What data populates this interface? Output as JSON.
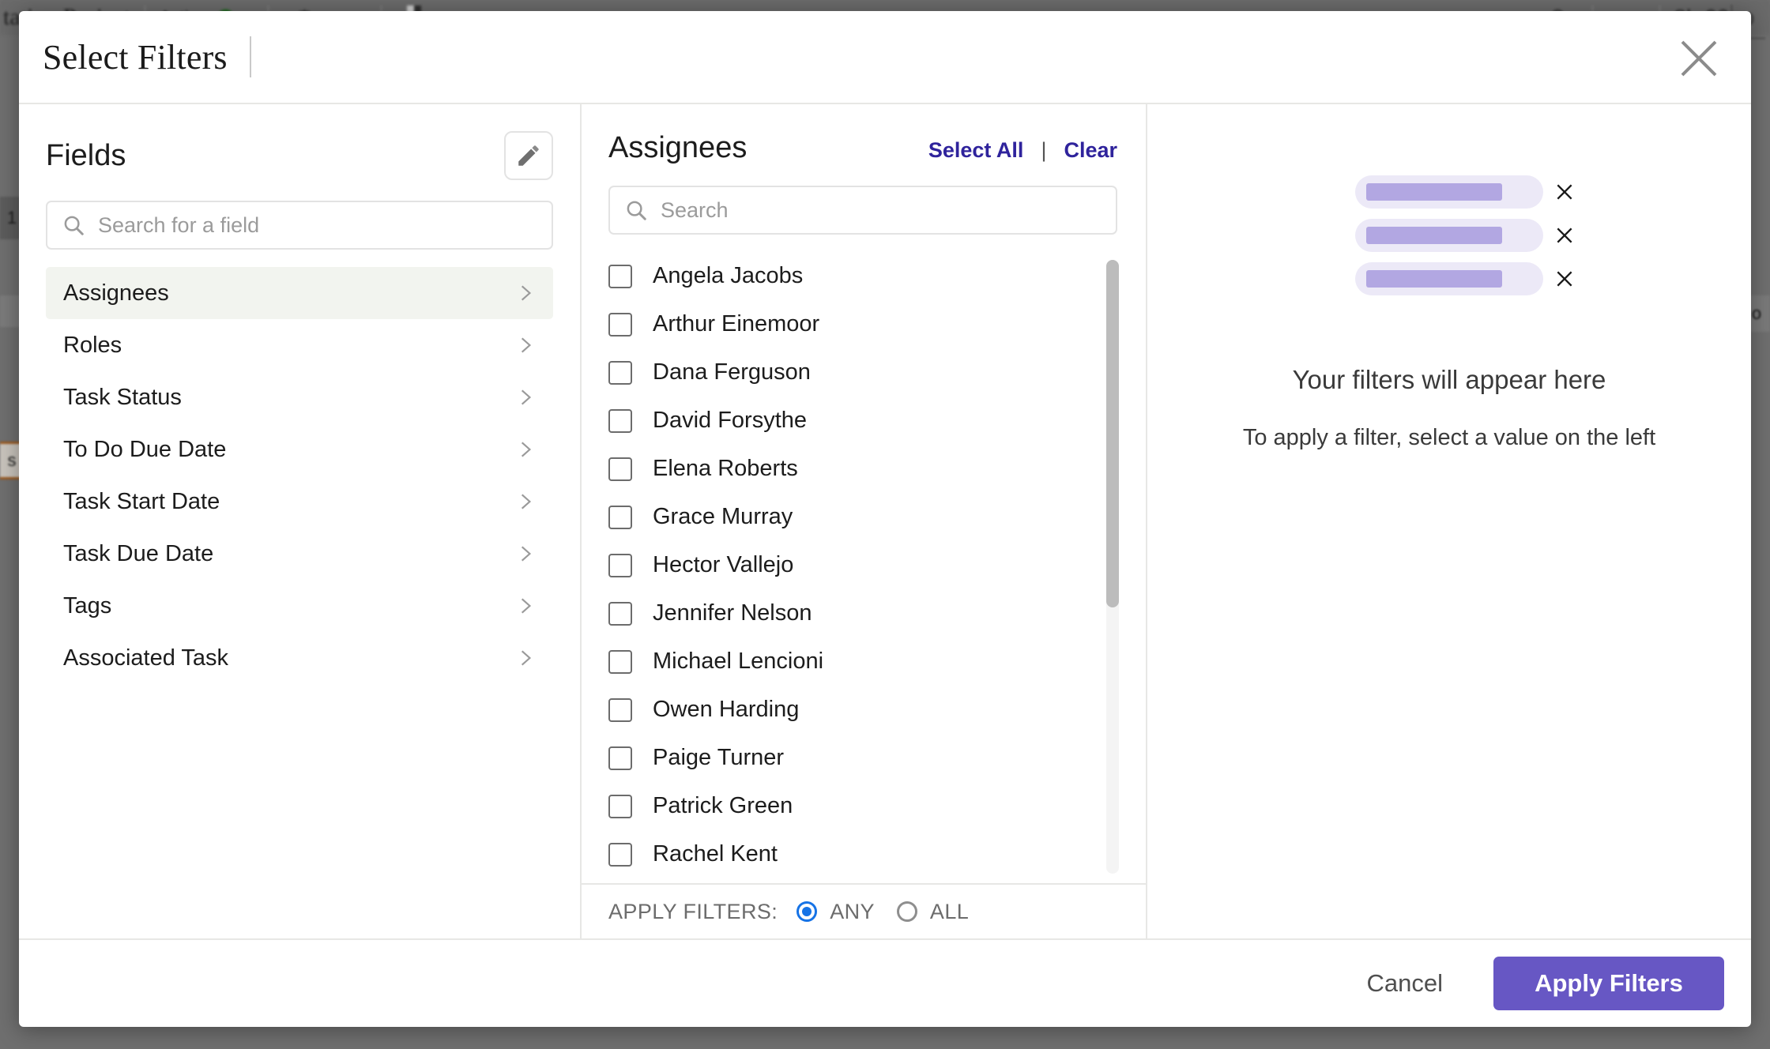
{
  "backdrop": {
    "project_title": "tation Project",
    "status_label": "Active",
    "timer_hours": "8h 00",
    "timer_seconds": "00",
    "left_marks": [
      "1",
      "s"
    ],
    "right_mark": "o",
    "icons": [
      "gear-icon",
      "magnet-icon",
      "search-icon",
      "timer-icon"
    ]
  },
  "modal": {
    "title": "Select Filters",
    "close_label": "close-icon"
  },
  "fields": {
    "heading": "Fields",
    "edit_label": "pencil-icon",
    "search_placeholder": "Search for a field",
    "search_value": "",
    "items": [
      {
        "label": "Assignees",
        "selected": true
      },
      {
        "label": "Roles",
        "selected": false
      },
      {
        "label": "Task Status",
        "selected": false
      },
      {
        "label": "To Do Due Date",
        "selected": false
      },
      {
        "label": "Task Start Date",
        "selected": false
      },
      {
        "label": "Task Due Date",
        "selected": false
      },
      {
        "label": "Tags",
        "selected": false
      },
      {
        "label": "Associated Task",
        "selected": false
      }
    ]
  },
  "values": {
    "heading": "Assignees",
    "select_all_label": "Select All",
    "separator": "|",
    "clear_label": "Clear",
    "search_placeholder": "Search",
    "search_value": "",
    "items": [
      {
        "name": "Angela Jacobs",
        "checked": false
      },
      {
        "name": "Arthur Einemoor",
        "checked": false
      },
      {
        "name": "Dana Ferguson",
        "checked": false
      },
      {
        "name": "David Forsythe",
        "checked": false
      },
      {
        "name": "Elena Roberts",
        "checked": false
      },
      {
        "name": "Grace Murray",
        "checked": false
      },
      {
        "name": "Hector Vallejo",
        "checked": false
      },
      {
        "name": "Jennifer Nelson",
        "checked": false
      },
      {
        "name": "Michael Lencioni",
        "checked": false
      },
      {
        "name": "Owen Harding",
        "checked": false
      },
      {
        "name": "Paige Turner",
        "checked": false
      },
      {
        "name": "Patrick Green",
        "checked": false
      },
      {
        "name": "Rachel Kent",
        "checked": false
      }
    ],
    "apply_mode": {
      "label": "APPLY FILTERS:",
      "options": [
        {
          "label": "ANY",
          "selected": true
        },
        {
          "label": "ALL",
          "selected": false
        }
      ]
    }
  },
  "preview": {
    "placeholder_chips": 3,
    "title": "Your filters will appear here",
    "subtitle": "To apply a filter, select a value on the left"
  },
  "footer": {
    "cancel_label": "Cancel",
    "apply_label": "Apply Filters"
  },
  "colors": {
    "accent_purple": "#6757c4",
    "link_indigo": "#2f239c",
    "radio_blue": "#1673e6",
    "chip_bg": "#ece9f7",
    "chip_bar": "#b2a7e2",
    "selected_row_bg": "#f2f4ef"
  }
}
